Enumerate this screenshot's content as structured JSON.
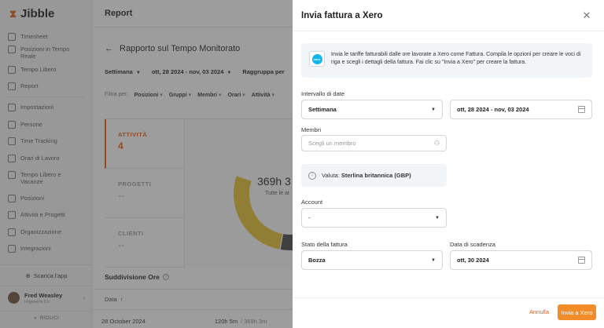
{
  "app": {
    "logo_text": "Jibble"
  },
  "sidebar": {
    "items_top": [
      {
        "label": "Timesheet",
        "icon": "clock-icon"
      },
      {
        "label": "Posizioni in Tempo Reale",
        "icon": "location-pin-icon"
      },
      {
        "label": "Tempo Libero",
        "icon": "calendar-icon"
      },
      {
        "label": "Report",
        "icon": "report-icon"
      }
    ],
    "items_settings": [
      {
        "label": "Impostazioni",
        "icon": "chevron-up-icon"
      },
      {
        "label": "Persone",
        "icon": "people-icon"
      },
      {
        "label": "Time Tracking",
        "icon": "time-tracking-icon"
      },
      {
        "label": "Orari di Lavoro",
        "icon": "work-schedule-icon"
      },
      {
        "label": "Tempo Libero e Vacanze",
        "icon": "vacation-icon"
      },
      {
        "label": "Posizioni",
        "icon": "location-icon"
      },
      {
        "label": "Attività e Progetti",
        "icon": "tag-icon"
      },
      {
        "label": "Organizzazione",
        "icon": "gear-icon"
      },
      {
        "label": "Integrazioni",
        "icon": "plug-icon"
      }
    ],
    "download_app": "Scarica l'app",
    "user": {
      "name": "Fred Weasley",
      "org": "Hogwarts Co"
    },
    "collapse": "RIDUCI"
  },
  "main": {
    "header_title": "Report",
    "page_title": "Rapporto sul Tempo Monitorato",
    "filters": {
      "period": "Settimana",
      "date_range": "ott, 28 2024 - nov, 03 2024",
      "group_by": "Raggruppa per"
    },
    "filter_by": {
      "label": "Filtra per:",
      "options": [
        "Posizioni",
        "Gruppi",
        "Membri",
        "Orari",
        "Attività"
      ]
    },
    "stats": [
      {
        "label": "ATTIVITÀ",
        "value": "4",
        "active": true
      },
      {
        "label": "PROGETTI",
        "value": "--",
        "active": false
      },
      {
        "label": "CLIENTI",
        "value": "--",
        "active": false
      }
    ],
    "donut": {
      "total": "369h 3",
      "label": "Tutte le at",
      "segments": [
        {
          "color": "#5b3b35",
          "value": 0.27
        },
        {
          "color": "#c2306e",
          "value": 0.07
        },
        {
          "color": "#5a3fc0",
          "value": 0.05
        },
        {
          "color": "#9aa0a6",
          "value": 0.05
        },
        {
          "color": "#444444",
          "value": 0.06
        },
        {
          "color": "#e5c12e",
          "value": 0.27
        }
      ]
    },
    "breakdown_title": "Suddivisione Ore",
    "table": {
      "header": "Data",
      "rows": [
        {
          "date": "28 October 2024",
          "hours": "120h 5m",
          "sub": "/ 369h 3m"
        }
      ]
    }
  },
  "panel": {
    "title": "Invia fattura a Xero",
    "xero_icon_text": "xero",
    "info": "Invia le tariffe fatturabili dalle ore lavorate a Xero come Fattura. Compila le opzioni per creare le voci di riga e scegli i dettagli della fattura. Fai clic su \"Invia a Xero\" per creare la fattura.",
    "date_interval_label": "Intervallo di date",
    "date_period": "Settimana",
    "date_range": "ott, 28 2024 - nov, 03 2024",
    "members_label": "Membri",
    "members_placeholder": "Scegli un membro",
    "currency_label": "Valuta:",
    "currency_value": "Sterlina britannica (GBP)",
    "account_label": "Account",
    "account_value": "-",
    "status_label": "Stato della fattura",
    "status_value": "Bozza",
    "due_label": "Data di scadenza",
    "due_value": "ott, 30 2024",
    "cancel": "Annulla",
    "submit": "Invia a Xero"
  }
}
